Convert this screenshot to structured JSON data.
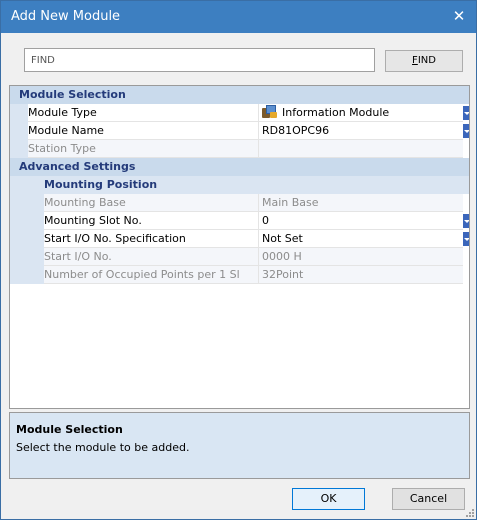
{
  "window": {
    "title": "Add New Module",
    "close_glyph": "✕"
  },
  "search": {
    "value": "FIND",
    "button_label_underlined": "F",
    "button_label_rest": "IND"
  },
  "grid": {
    "module_selection": {
      "label": "Module Selection",
      "module_type": {
        "name": "Module Type",
        "value": "Information Module",
        "icon": "module-icon"
      },
      "module_name": {
        "name": "Module Name",
        "value": "RD81OPC96"
      },
      "station_type": {
        "name": "Station Type",
        "value": ""
      }
    },
    "advanced_settings": {
      "label": "Advanced Settings",
      "mounting_position": {
        "label": "Mounting Position",
        "mounting_base": {
          "name": "Mounting Base",
          "value": "Main Base"
        },
        "mounting_slot": {
          "name": "Mounting Slot No.",
          "value": "0"
        },
        "start_io_spec": {
          "name": "Start I/O No. Specification",
          "value": "Not Set"
        },
        "start_io": {
          "name": "Start I/O No.",
          "value": "0000 H"
        },
        "occupied_points": {
          "name": "Number of Occupied Points per 1 Sl",
          "value": "32Point"
        }
      }
    }
  },
  "description": {
    "title": "Module Selection",
    "text": "Select the module to be added."
  },
  "buttons": {
    "ok": "OK",
    "cancel": "Cancel"
  },
  "colors": {
    "titlebar": "#3d7fc1",
    "category_bg": "#c9daec",
    "category_text": "#243b7a",
    "dropdown": "#3b66bb",
    "desc_bg": "#d9e6f3"
  }
}
